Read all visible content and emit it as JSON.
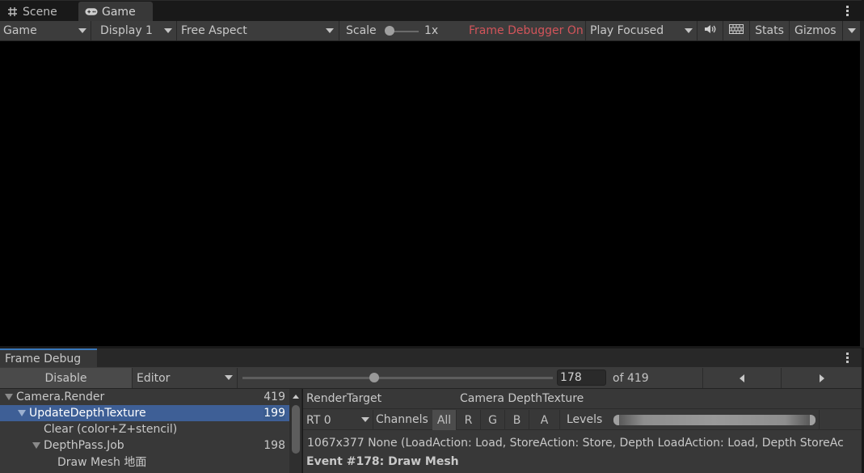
{
  "tabs": [
    {
      "label": "Scene",
      "icon": "grid-icon",
      "active": false
    },
    {
      "label": "Game",
      "icon": "gamepad-icon",
      "active": true
    }
  ],
  "game_toolbar": {
    "view_dropdown": "Game",
    "display_dropdown": "Display 1",
    "aspect_dropdown": "Free Aspect",
    "scale_label": "Scale",
    "scale_value": "1x",
    "scale_fraction": 0.0,
    "frame_debugger_status": "Frame Debugger On",
    "play_mode_dropdown": "Play Focused",
    "mute_icon": "speaker-icon",
    "keyboard_icon": "keyboard-icon",
    "stats_label": "Stats",
    "gizmos_label": "Gizmos",
    "status_color": "#d2545a"
  },
  "frame_debug": {
    "tab_label": "Frame Debug",
    "accent_color": "#3a79bb",
    "disable_label": "Disable",
    "target_dropdown": "Editor",
    "event_current": "178",
    "event_total_label": "of 419",
    "event_current_num": 178,
    "event_total_num": 419,
    "tree": [
      {
        "label": "Camera.Render",
        "count": "419",
        "depth": 0,
        "foldout": true,
        "selected": false
      },
      {
        "label": "UpdateDepthTexture",
        "count": "199",
        "depth": 1,
        "foldout": true,
        "selected": true
      },
      {
        "label": "Clear (color+Z+stencil)",
        "count": "",
        "depth": 2,
        "foldout": false,
        "selected": false
      },
      {
        "label": "DepthPass.Job",
        "count": "198",
        "depth": 2,
        "foldout": true,
        "selected": false
      },
      {
        "label": "Draw Mesh 地面",
        "count": "",
        "depth": 3,
        "foldout": false,
        "selected": false
      }
    ],
    "details": {
      "render_target_label": "RenderTarget",
      "render_target_value": "Camera DepthTexture",
      "rt_dropdown": "RT 0",
      "channels_label": "Channels",
      "channels": [
        "All",
        "R",
        "G",
        "B",
        "A"
      ],
      "active_channel": "All",
      "levels_label": "Levels",
      "info_line": "1067x377 None (LoadAction: Load, StoreAction: Store, Depth LoadAction: Load, Depth StoreAc",
      "event_title": "Event #178: Draw Mesh"
    }
  }
}
